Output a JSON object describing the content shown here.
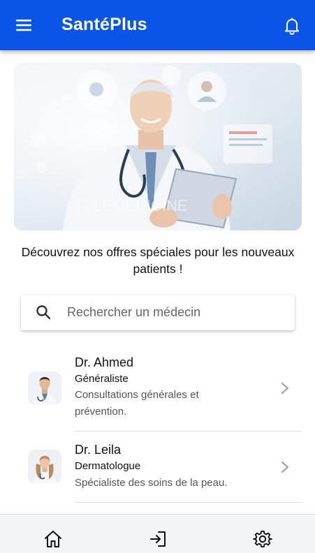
{
  "app": {
    "title": "SantéPlus"
  },
  "header": {
    "menu_icon": "hamburger-menu-icon",
    "notifications_icon": "bell-icon",
    "bg_color": "#0a55e6"
  },
  "banner": {
    "watermark_text": "TELEMEDICINE"
  },
  "promo": {
    "text": "Découvrez nos offres spéciales pour les nouveaux patients !"
  },
  "search": {
    "placeholder": "Rechercher un médecin",
    "value": "",
    "icon": "search-icon"
  },
  "doctors": [
    {
      "name": "Dr. Ahmed",
      "specialty": "Généraliste",
      "description": "Consultations générales et prévention."
    },
    {
      "name": "Dr. Leila",
      "specialty": "Dermatologue",
      "description": "Spécialiste des soins de la peau."
    }
  ],
  "bottom_nav": {
    "items": [
      {
        "icon": "home-icon"
      },
      {
        "icon": "login-icon"
      },
      {
        "icon": "settings-gear-icon"
      }
    ]
  }
}
